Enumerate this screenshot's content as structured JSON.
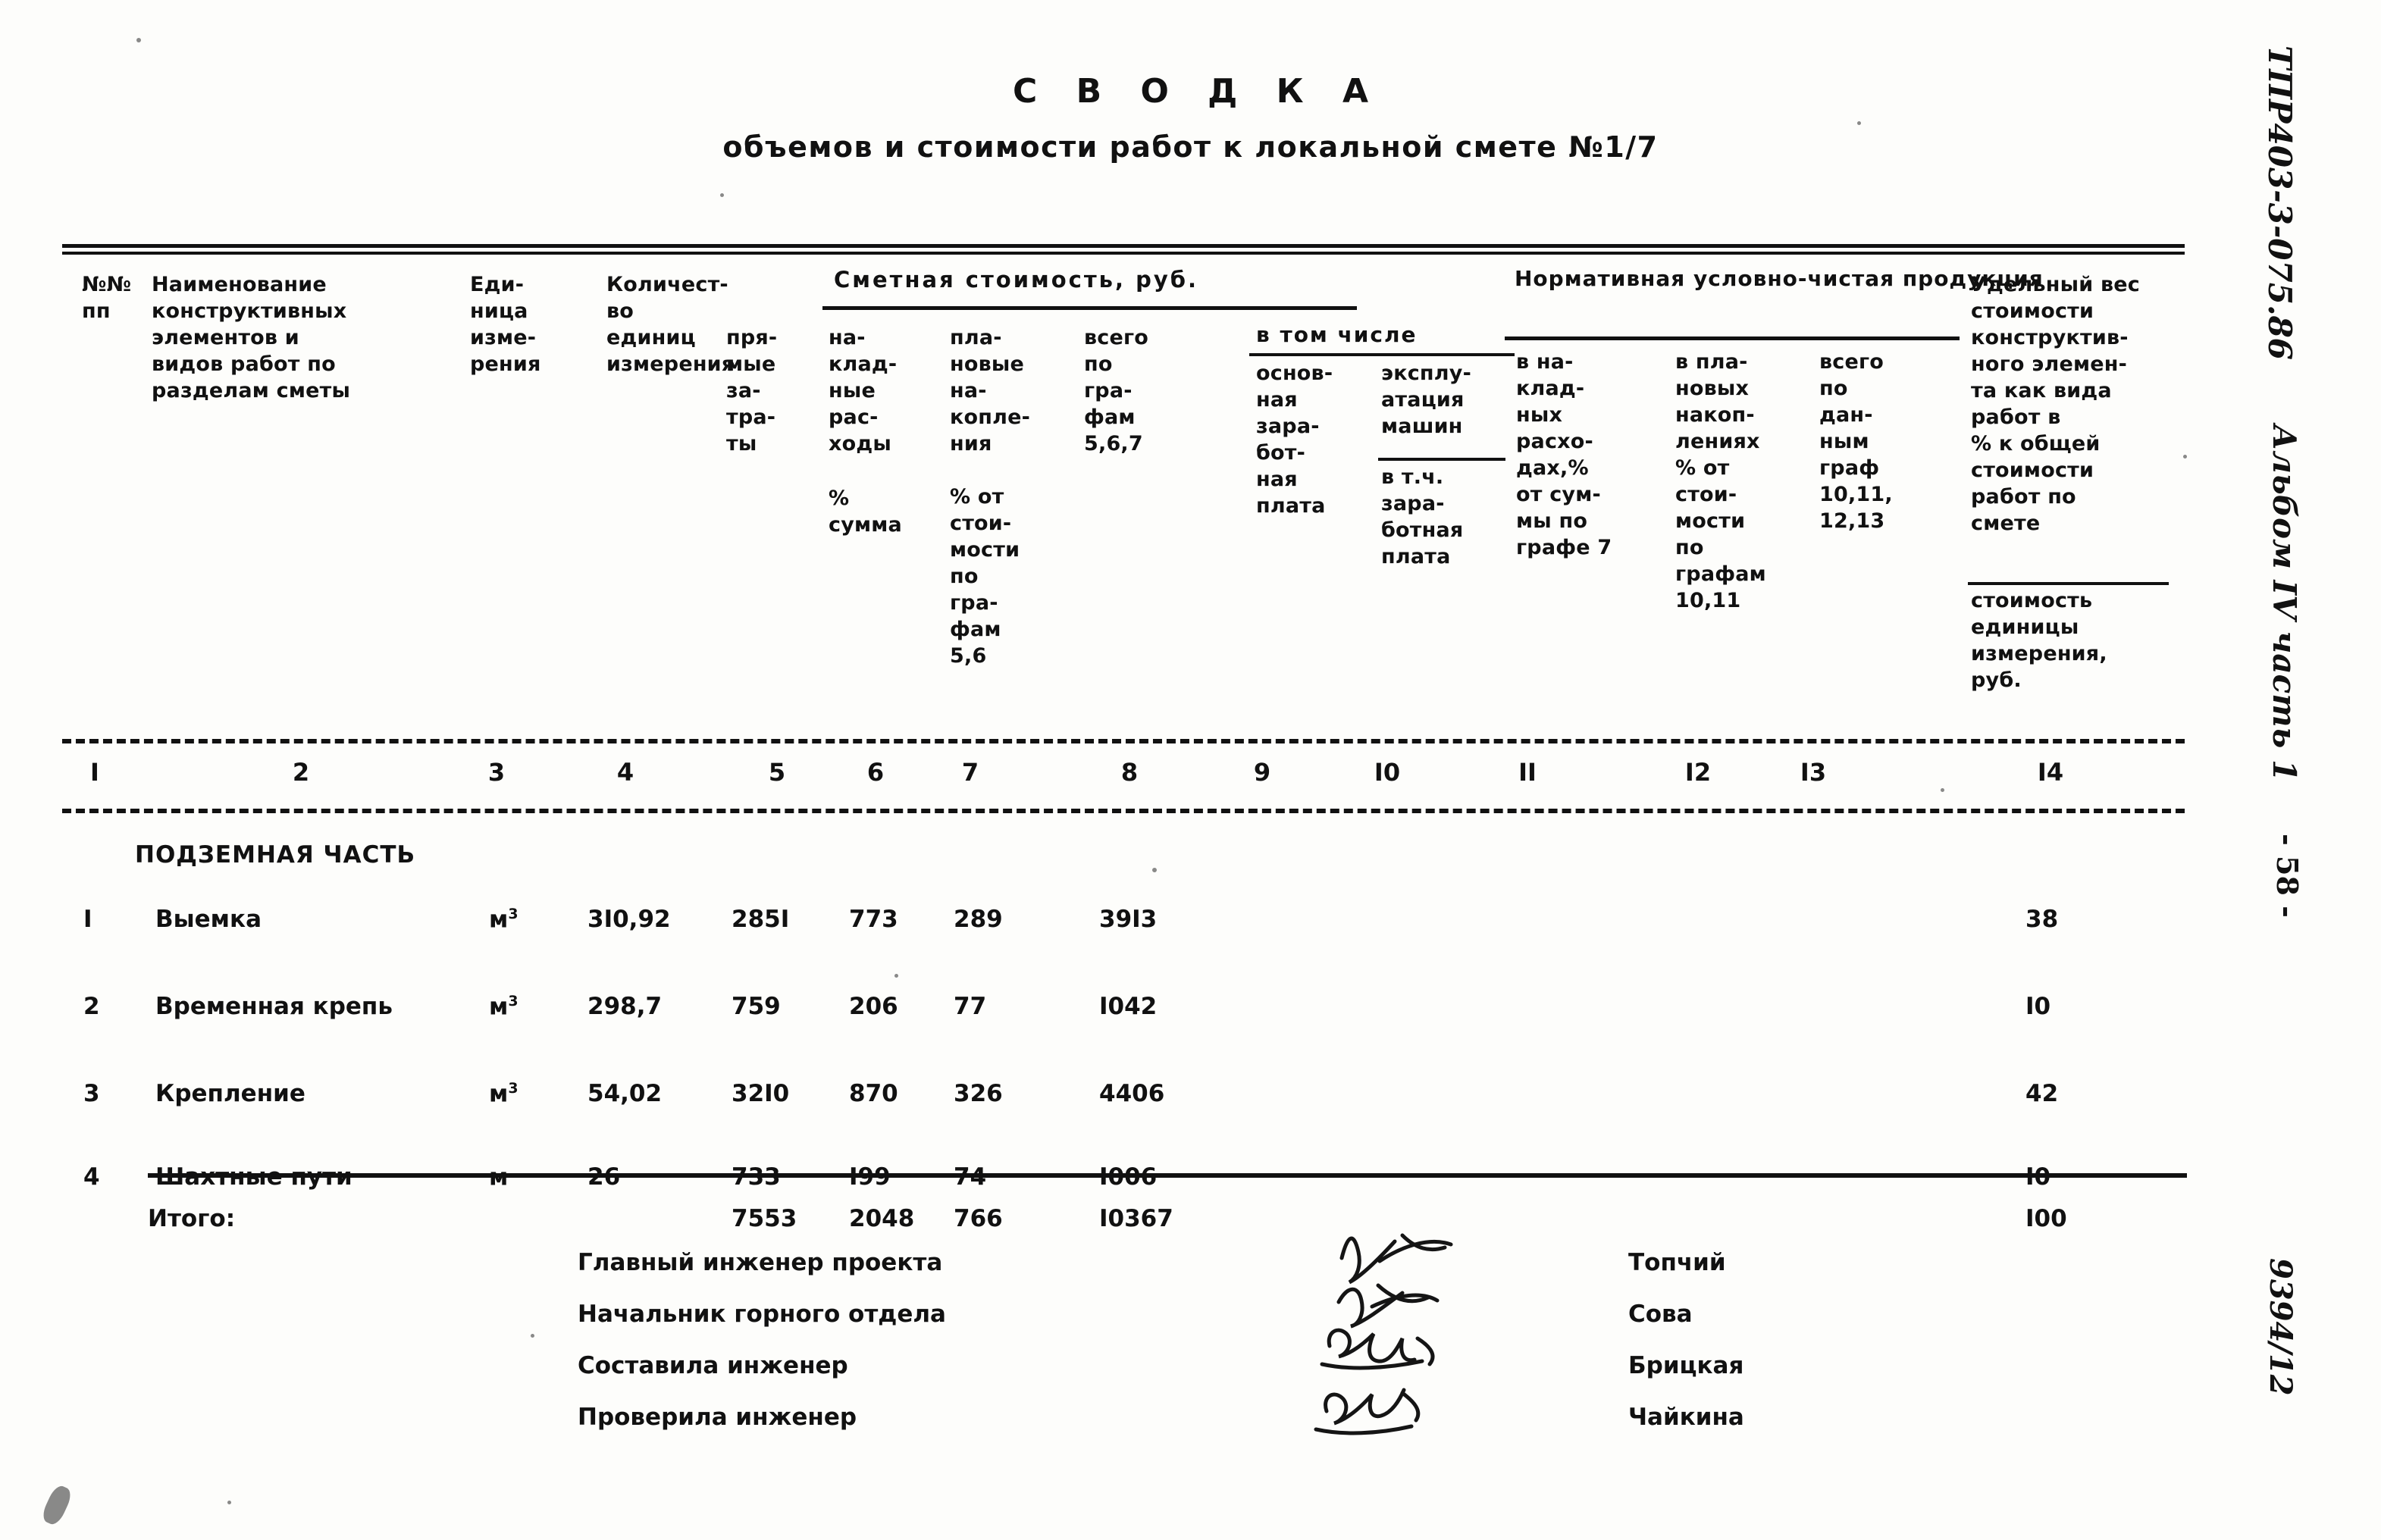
{
  "document": {
    "title": "С В О Д К А",
    "subtitle": "объемов и стоимости работ к локальной смете №1/7"
  },
  "table": {
    "group_headers": {
      "smetnaya": "Сметная стоимость, руб.",
      "v_tom_chisle": "в том числе",
      "normativnaya": "Нормативная условно-чистая продукция"
    },
    "headers": {
      "c1": "№№\nпп",
      "c2": "Наименование\nконструктивных\nэлементов и\nвидов работ по\nразделам сметы",
      "c3": "Еди-\nница\nизме-\nрения",
      "c4": "Количест-\nво\nединиц\nизмерения",
      "c5": "пря-\nмые\nза-\nтра-\nты",
      "c6": "на-\nклад-\nные\nрас-\nходы",
      "c6b": "%\nсумма",
      "c7": "пла-\nновые\nна-\nкопле-\nния",
      "c7b": "% от\nстои-\nмости\nпо\nгра-\nфам\n5,6",
      "c8": "всего\nпо\nгра-\nфам\n5,6,7",
      "c9": "основ-\nная\nзара-\nбот-\nная\nплата",
      "c10": "эксплу-\nатация\nмашин",
      "c10b": "в т.ч.\nзара-\nботная\nплата",
      "c11": "в на-\nклад-\nных\nрасхо-\nдах,%\nот сум-\nмы по\nграфе 7",
      "c12": "в пла-\nновых\nнакоп-\nлениях\n% от\nстои-\nмости\nпо\nграфам\n10,11",
      "c13": "всего\nпо\nдан-\nным\nграф\n10,11,\n12,13",
      "c14": "Удельный вес\nстоимости\nконструктив-\nного элемен-\nта как вида\nработ в\n% к общей\nстоимости\nработ по\nсмете",
      "c14b": "стоимость\nединицы\nизмерения,\nруб."
    },
    "column_numbers": [
      "I",
      "2",
      "3",
      "4",
      "5",
      "6",
      "7",
      "8",
      "9",
      "I0",
      "II",
      "I2",
      "I3",
      "I4"
    ],
    "section": "ПОДЗЕМНАЯ ЧАСТЬ",
    "rows": [
      {
        "no": "I",
        "name": "Выемка",
        "unit": "м",
        "unit_sup": "3",
        "qty": "3I0,92",
        "direct": "285I",
        "overhead": "773",
        "savings": "289",
        "total": "39I3",
        "share": "38"
      },
      {
        "no": "2",
        "name": "Временная крепь",
        "unit": "м",
        "unit_sup": "3",
        "qty": "298,7",
        "direct": "759",
        "overhead": "206",
        "savings": "77",
        "total": "I042",
        "share": "I0"
      },
      {
        "no": "3",
        "name": "Крепление",
        "unit": "м",
        "unit_sup": "3",
        "qty": "54,02",
        "direct": "32I0",
        "overhead": "870",
        "savings": "326",
        "total": "4406",
        "share": "42"
      },
      {
        "no": "4",
        "name": "Шахтные пути",
        "unit": "м",
        "unit_sup": "",
        "qty": "26",
        "direct": "733",
        "overhead": "I99",
        "savings": "74",
        "total": "I006",
        "share": "I0"
      }
    ],
    "total_row": {
      "label": "Итого:",
      "direct": "7553",
      "overhead": "2048",
      "savings": "766",
      "total": "I0367",
      "share": "I00"
    }
  },
  "signatures": [
    {
      "role": "Главный инженер проекта",
      "name": "Топчий"
    },
    {
      "role": "Начальник горного отдела",
      "name": "Сова"
    },
    {
      "role": "Составила инженер",
      "name": "Брицкая"
    },
    {
      "role": "Проверила инженер",
      "name": "Чайкина"
    }
  ],
  "margin": {
    "code": "ТПР403-3-075.86",
    "album": "Альбом IV часть 1",
    "page": "- 58 -",
    "archive": "9394/12"
  }
}
